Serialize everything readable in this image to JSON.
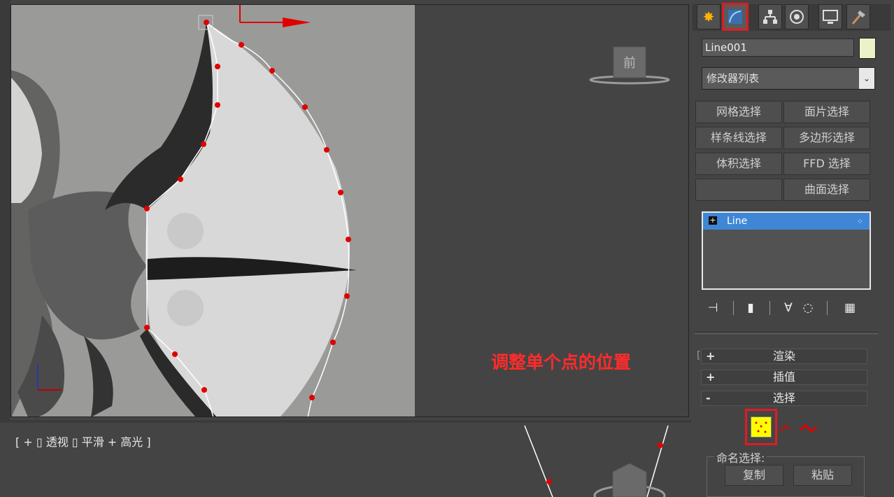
{
  "top_viewport": {
    "view_cube_label": "前"
  },
  "annotation": {
    "text": "调整单个点的位置",
    "color": "#ff2b2b"
  },
  "bottom_viewport": {
    "label": "[ + ▯ 透视 ▯ 平滑 + 高光 ]"
  },
  "command_panel": {
    "tabs": [
      {
        "icon": "create-icon",
        "active": false
      },
      {
        "icon": "modify-icon",
        "active": true
      },
      {
        "icon": "hierarchy-icon",
        "active": false
      },
      {
        "icon": "motion-icon",
        "active": false
      },
      {
        "icon": "display-icon",
        "active": false
      },
      {
        "icon": "utilities-icon",
        "active": false
      }
    ],
    "object_name": "Line001",
    "object_color": "#eaf3c8",
    "modifier_list": "修改器列表",
    "modifier_buttons": [
      "网格选择",
      "面片选择",
      "样条线选择",
      "多边形选择",
      "体积选择",
      "FFD 选择",
      "",
      "曲面选择"
    ],
    "stack": {
      "items": [
        {
          "label": "Line"
        }
      ]
    },
    "rollouts": [
      {
        "sign": "+",
        "title": "渲染"
      },
      {
        "sign": "+",
        "title": "插值"
      },
      {
        "sign": "-",
        "title": "选择"
      }
    ],
    "named_selection": {
      "label": "命名选择:",
      "copy": "复制",
      "paste": "粘贴"
    },
    "accent_color": "#e01b24"
  }
}
